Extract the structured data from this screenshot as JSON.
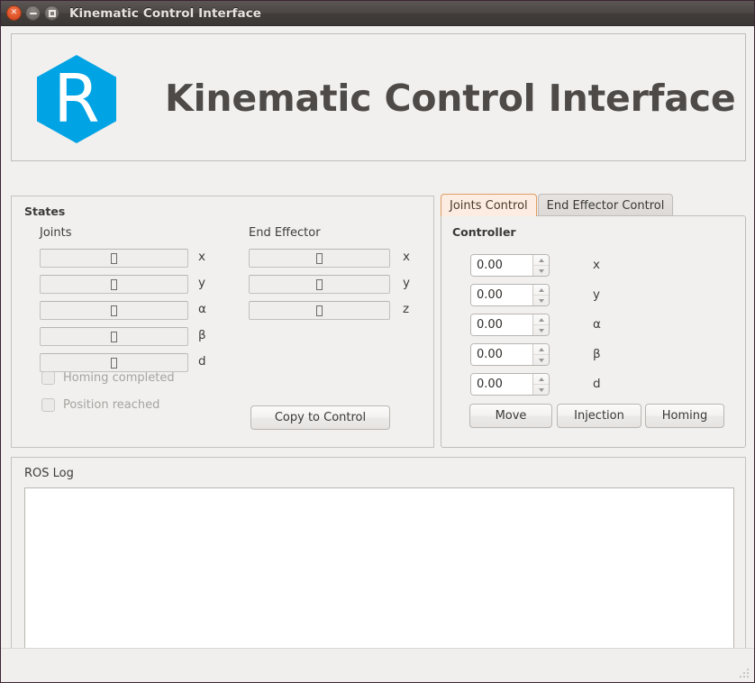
{
  "window": {
    "title": "Kinematic Control Interface",
    "buttons": {
      "close": "×",
      "minimize": "minimize",
      "maximize": "maximize"
    }
  },
  "header": {
    "brand_title": "Kinematic Control Interface",
    "logo_letter": "R",
    "logo_color": "#00a3e4"
  },
  "states": {
    "group_title": "States",
    "joints": {
      "label": "Joints",
      "rows": [
        {
          "value": "□",
          "axis": "x"
        },
        {
          "value": "□",
          "axis": "y"
        },
        {
          "value": "□",
          "axis": "α"
        },
        {
          "value": "□",
          "axis": "β"
        },
        {
          "value": "□",
          "axis": "d"
        }
      ]
    },
    "end_effector": {
      "label": "End Effector",
      "rows": [
        {
          "value": "□",
          "axis": "x"
        },
        {
          "value": "□",
          "axis": "y"
        },
        {
          "value": "□",
          "axis": "z"
        }
      ]
    },
    "checkboxes": [
      {
        "label": "Homing completed",
        "checked": false,
        "enabled": false
      },
      {
        "label": "Position reached",
        "checked": false,
        "enabled": false
      }
    ],
    "copy_button": "Copy to Control"
  },
  "control_tabs": {
    "tabs": [
      {
        "label": "Joints Control",
        "active": true
      },
      {
        "label": "End Effector Control",
        "active": false
      }
    ],
    "active_tab_accent": "#e09c62",
    "controller": {
      "title": "Controller",
      "rows": [
        {
          "value": "0.00",
          "axis": "x"
        },
        {
          "value": "0.00",
          "axis": "y"
        },
        {
          "value": "0.00",
          "axis": "α"
        },
        {
          "value": "0.00",
          "axis": "β"
        },
        {
          "value": "0.00",
          "axis": "d"
        }
      ],
      "buttons": [
        {
          "label": "Move"
        },
        {
          "label": "Injection"
        },
        {
          "label": "Homing"
        }
      ]
    }
  },
  "log": {
    "label": "ROS Log",
    "content": ""
  }
}
